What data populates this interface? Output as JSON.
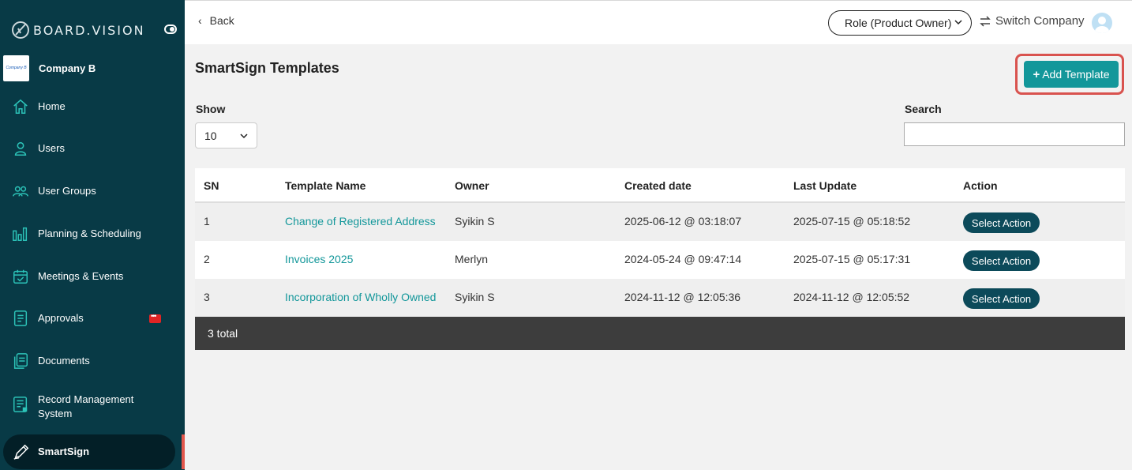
{
  "brand": {
    "name": "BOARD.VISION"
  },
  "company": {
    "name": "Company B",
    "logo_text": "Company B"
  },
  "sidebar": {
    "items": [
      {
        "label": "Home",
        "icon": "home-icon"
      },
      {
        "label": "Users",
        "icon": "user-icon"
      },
      {
        "label": "User Groups",
        "icon": "user-groups-icon"
      },
      {
        "label": "Planning & Scheduling",
        "icon": "bar-chart-icon"
      },
      {
        "label": "Meetings & Events",
        "icon": "calendar-icon"
      },
      {
        "label": "Approvals",
        "icon": "approvals-icon"
      },
      {
        "label": "Documents",
        "icon": "documents-icon"
      },
      {
        "label": "Record Management System",
        "icon": "record-icon"
      },
      {
        "label": "SmartSign",
        "icon": "pen-icon",
        "active": true
      }
    ]
  },
  "topbar": {
    "back_label": "Back",
    "role_label": "Role (Product Owner)",
    "switch_label": "Switch Company"
  },
  "page": {
    "title": "SmartSign Templates",
    "add_button_label": "Add Template",
    "show_label": "Show",
    "show_value": "10",
    "search_label": "Search",
    "search_value": "",
    "search_placeholder": ""
  },
  "table": {
    "headers": [
      "SN",
      "Template Name",
      "Owner",
      "Created date",
      "Last Update",
      "Action"
    ],
    "rows": [
      {
        "sn": "1",
        "name": "Change of Registered Address",
        "owner": "Syikin S",
        "created": "2025-06-12 @ 03:18:07",
        "updated": "2025-07-15 @ 05:18:52",
        "action": "Select Action"
      },
      {
        "sn": "2",
        "name": "Invoices 2025",
        "owner": "Merlyn",
        "created": "2024-05-24 @ 09:47:14",
        "updated": "2025-07-15 @ 05:17:31",
        "action": "Select Action"
      },
      {
        "sn": "3",
        "name": "Incorporation of Wholly Owned",
        "owner": "Syikin S",
        "created": "2024-11-12 @ 12:05:36",
        "updated": "2024-11-12 @ 12:05:52",
        "action": "Select Action"
      }
    ],
    "footer_total": "3 total"
  },
  "colors": {
    "sidebar_bg": "#083a46",
    "accent": "#13979a",
    "action_button": "#0c4a5a",
    "highlight_border": "#d9534f"
  }
}
